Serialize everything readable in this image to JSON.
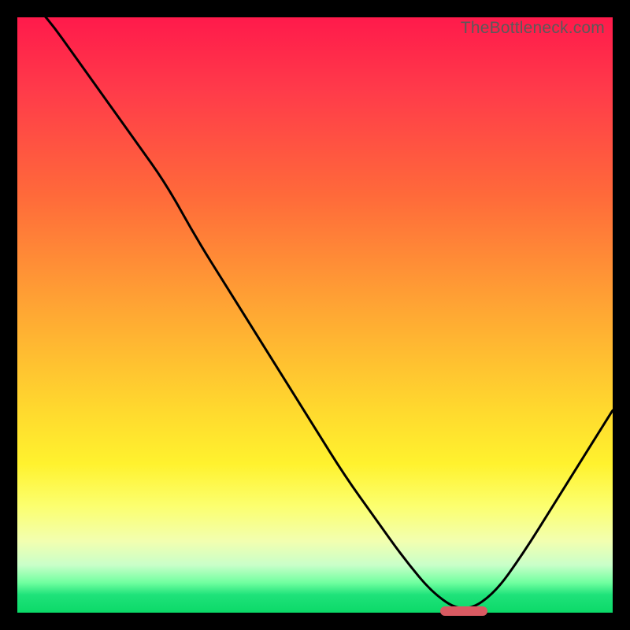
{
  "watermark": "TheBottleneck.com",
  "colors": {
    "frame": "#000000",
    "curve": "#000000",
    "marker": "#d95a62"
  },
  "chart_data": {
    "type": "line",
    "title": "",
    "xlabel": "",
    "ylabel": "",
    "xlim": [
      0,
      100
    ],
    "ylim": [
      0,
      100
    ],
    "x": [
      0,
      5,
      10,
      15,
      20,
      25,
      30,
      35,
      40,
      45,
      50,
      55,
      60,
      65,
      70,
      75,
      80,
      85,
      90,
      95,
      100
    ],
    "values": [
      105,
      100,
      93,
      86,
      79,
      72,
      63,
      55,
      47,
      39,
      31,
      23,
      16,
      9,
      3,
      0,
      3,
      10,
      18,
      26,
      34
    ],
    "marker": {
      "x_start": 71,
      "x_end": 79,
      "y": 0
    },
    "background_gradient": [
      {
        "stop": 0,
        "color": "#ff1a4b"
      },
      {
        "stop": 12,
        "color": "#ff3a4a"
      },
      {
        "stop": 30,
        "color": "#ff6a3a"
      },
      {
        "stop": 50,
        "color": "#ffa933"
      },
      {
        "stop": 66,
        "color": "#ffd92e"
      },
      {
        "stop": 75,
        "color": "#fff22e"
      },
      {
        "stop": 82,
        "color": "#fcff6e"
      },
      {
        "stop": 88,
        "color": "#f2ffb0"
      },
      {
        "stop": 92,
        "color": "#c9ffc9"
      },
      {
        "stop": 95,
        "color": "#6fff9f"
      },
      {
        "stop": 97,
        "color": "#1fe27a"
      },
      {
        "stop": 100,
        "color": "#0bd968"
      }
    ]
  }
}
